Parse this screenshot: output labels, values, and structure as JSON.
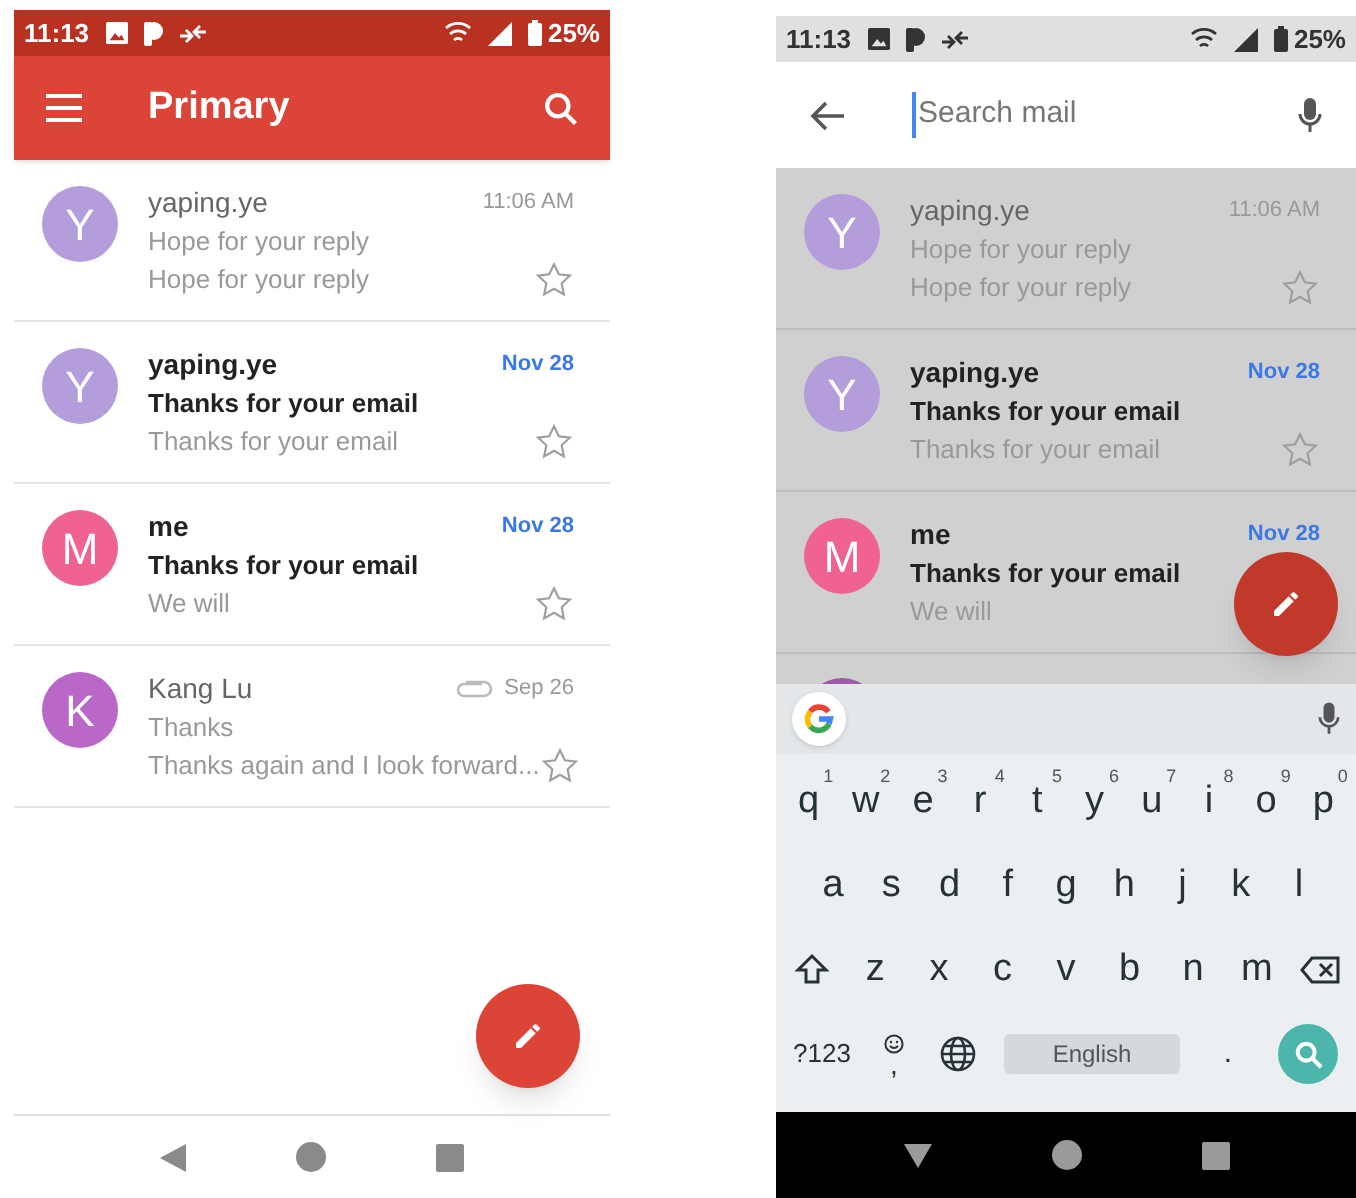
{
  "screens": [
    {
      "kind": "inbox",
      "dimmed": false,
      "status_bar": {
        "time": "11:13",
        "battery": "25%"
      },
      "toolbar": {
        "title": "Primary"
      },
      "emails": [
        {
          "avatar": "Y",
          "color": "#b39ddb",
          "sender": "yaping.ye",
          "subject": "Hope for your reply",
          "snippet": "Hope for your reply",
          "date": "11:06 AM",
          "unread": false,
          "attachment": false,
          "starred": false
        },
        {
          "avatar": "Y",
          "color": "#b39ddb",
          "sender": "yaping.ye",
          "subject": "Thanks for your email",
          "snippet": "Thanks for your email",
          "date": "Nov 28",
          "unread": true,
          "attachment": false,
          "starred": false
        },
        {
          "avatar": "M",
          "color": "#f06292",
          "sender": "me",
          "subject": "Thanks for your email",
          "snippet": "We will",
          "date": "Nov 28",
          "unread": true,
          "attachment": false,
          "starred": false
        },
        {
          "avatar": "K",
          "color": "#ba68c8",
          "sender": "Kang Lu",
          "subject": "Thanks",
          "snippet": "Thanks again and I look forward...",
          "date": "Sep 26",
          "unread": false,
          "attachment": true,
          "starred": false
        }
      ]
    },
    {
      "kind": "search",
      "dimmed": true,
      "status_bar": {
        "time": "11:13",
        "battery": "25%"
      },
      "search": {
        "placeholder": "Search mail"
      },
      "emails": [
        {
          "avatar": "Y",
          "color": "#b39ddb",
          "sender": "yaping.ye",
          "subject": "Hope for your reply",
          "snippet": "Hope for your reply",
          "date": "11:06 AM",
          "unread": false,
          "attachment": false,
          "starred": false
        },
        {
          "avatar": "Y",
          "color": "#b39ddb",
          "sender": "yaping.ye",
          "subject": "Thanks for your email",
          "snippet": "Thanks for your email",
          "date": "Nov 28",
          "unread": true,
          "attachment": false,
          "starred": false
        },
        {
          "avatar": "M",
          "color": "#f06292",
          "sender": "me",
          "subject": "Thanks for your email",
          "snippet": "We will",
          "date": "Nov 28",
          "unread": true,
          "attachment": false
        }
      ],
      "keyboard": {
        "key_rows": [
          {
            "keys": [
              {
                "kind": "letter",
                "label": "q",
                "hint": "1"
              },
              {
                "kind": "letter",
                "label": "w",
                "hint": "2"
              },
              {
                "kind": "letter",
                "label": "e",
                "hint": "3"
              },
              {
                "kind": "letter",
                "label": "r",
                "hint": "4"
              },
              {
                "kind": "letter",
                "label": "t",
                "hint": "5"
              },
              {
                "kind": "letter",
                "label": "y",
                "hint": "6"
              },
              {
                "kind": "letter",
                "label": "u",
                "hint": "7"
              },
              {
                "kind": "letter",
                "label": "i",
                "hint": "8"
              },
              {
                "kind": "letter",
                "label": "o",
                "hint": "9"
              },
              {
                "kind": "letter",
                "label": "p",
                "hint": "0"
              }
            ]
          },
          {
            "keys": [
              {
                "kind": "letter",
                "label": "a"
              },
              {
                "kind": "letter",
                "label": "s"
              },
              {
                "kind": "letter",
                "label": "d"
              },
              {
                "kind": "letter",
                "label": "f"
              },
              {
                "kind": "letter",
                "label": "g"
              },
              {
                "kind": "letter",
                "label": "h"
              },
              {
                "kind": "letter",
                "label": "j"
              },
              {
                "kind": "letter",
                "label": "k"
              },
              {
                "kind": "letter",
                "label": "l"
              }
            ]
          },
          {
            "keys": [
              {
                "kind": "shift"
              },
              {
                "kind": "letter",
                "label": "z"
              },
              {
                "kind": "letter",
                "label": "x"
              },
              {
                "kind": "letter",
                "label": "c"
              },
              {
                "kind": "letter",
                "label": "v"
              },
              {
                "kind": "letter",
                "label": "b"
              },
              {
                "kind": "letter",
                "label": "n"
              },
              {
                "kind": "letter",
                "label": "m"
              },
              {
                "kind": "backspace"
              }
            ]
          },
          {
            "keys": [
              {
                "kind": "symbols",
                "label": "?123"
              },
              {
                "kind": "emoji",
                "label": ","
              },
              {
                "kind": "globe"
              },
              {
                "kind": "space",
                "label": "English"
              },
              {
                "kind": "period",
                "label": "."
              },
              {
                "kind": "search"
              }
            ]
          }
        ]
      }
    }
  ]
}
